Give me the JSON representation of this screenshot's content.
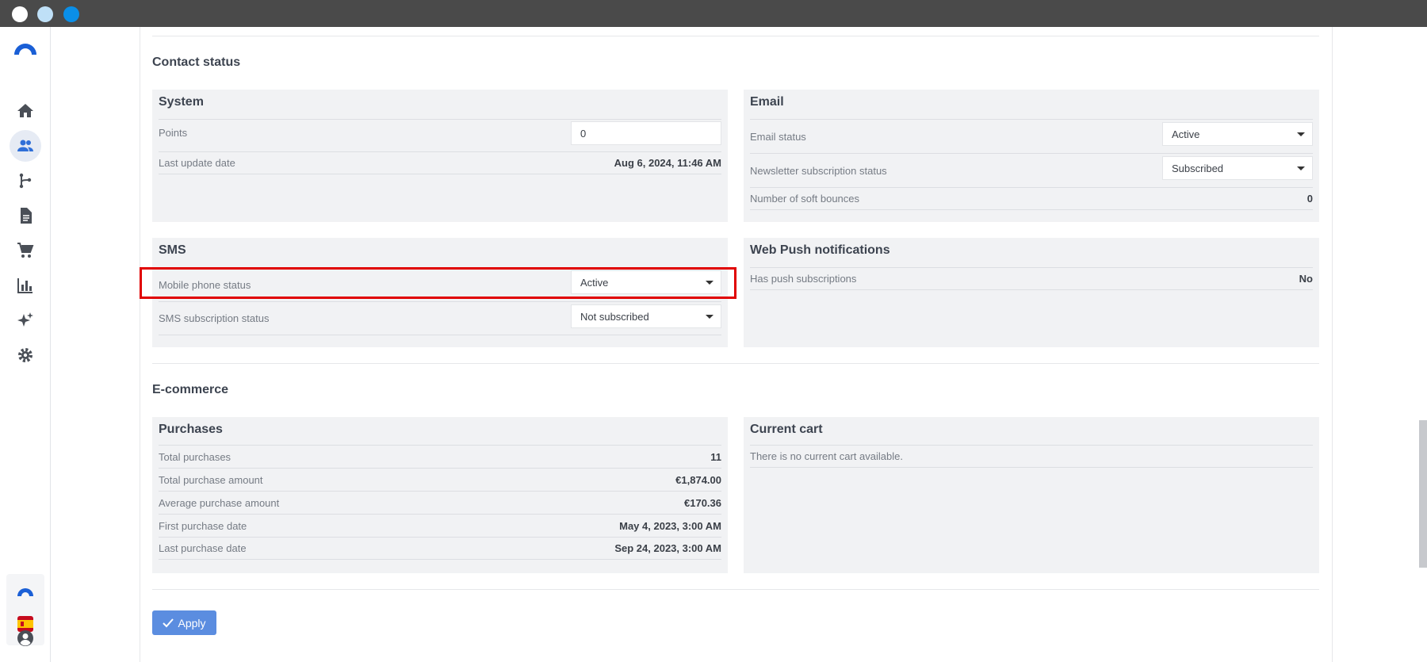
{
  "colors": {
    "accent": "#5b8de0",
    "highlight": "#e00000",
    "panel": "#f1f2f4"
  },
  "sidebar": {
    "items": [
      {
        "icon": "home-icon"
      },
      {
        "icon": "contacts-icon",
        "active": true
      },
      {
        "icon": "workflow-icon"
      },
      {
        "icon": "document-icon"
      },
      {
        "icon": "cart-icon"
      },
      {
        "icon": "chart-icon"
      },
      {
        "icon": "sparkle-icon"
      },
      {
        "icon": "gear-icon"
      }
    ],
    "bottom": [
      "brand-logo-icon",
      "spain-flag-icon",
      "user-avatar-icon"
    ]
  },
  "contact_status": {
    "title": "Contact status",
    "system": {
      "title": "System",
      "points_label": "Points",
      "points_value": "0",
      "last_update_label": "Last update date",
      "last_update_value": "Aug 6, 2024, 11:46 AM"
    },
    "email": {
      "title": "Email",
      "email_status_label": "Email status",
      "email_status_value": "Active",
      "newsletter_label": "Newsletter subscription status",
      "newsletter_value": "Subscribed",
      "soft_bounces_label": "Number of soft bounces",
      "soft_bounces_value": "0"
    },
    "sms": {
      "title": "SMS",
      "mobile_status_label": "Mobile phone status",
      "mobile_status_value": "Active",
      "sms_subscription_label": "SMS subscription status",
      "sms_subscription_value": "Not subscribed"
    },
    "web_push": {
      "title": "Web Push notifications",
      "push_label": "Has push subscriptions",
      "push_value": "No"
    }
  },
  "ecommerce": {
    "title": "E-commerce",
    "purchases": {
      "title": "Purchases",
      "rows": [
        {
          "label": "Total purchases",
          "value": "11"
        },
        {
          "label": "Total purchase amount",
          "value": "€1,874.00"
        },
        {
          "label": "Average purchase amount",
          "value": "€170.36"
        },
        {
          "label": "First purchase date",
          "value": "May 4, 2023, 3:00 AM"
        },
        {
          "label": "Last purchase date",
          "value": "Sep 24, 2023, 3:00 AM"
        }
      ]
    },
    "current_cart": {
      "title": "Current cart",
      "empty_text": "There is no current cart available."
    }
  },
  "apply_label": "Apply"
}
